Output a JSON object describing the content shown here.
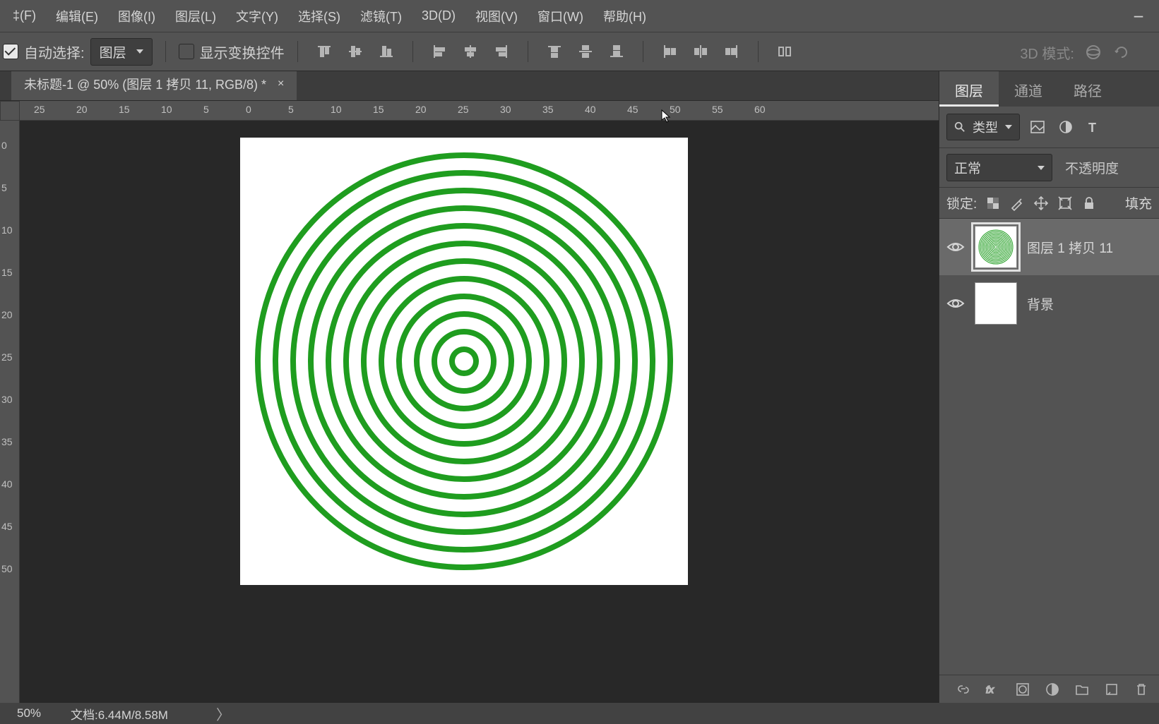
{
  "menu": {
    "file": "‡(F)",
    "edit": "编辑(E)",
    "image": "图像(I)",
    "layer": "图层(L)",
    "type": "文字(Y)",
    "select": "选择(S)",
    "filter": "滤镜(T)",
    "threeD": "3D(D)",
    "view": "视图(V)",
    "window": "窗口(W)",
    "help": "帮助(H)"
  },
  "options": {
    "auto_select": "自动选择:",
    "select_target": "图层",
    "show_transform": "显示变换控件",
    "mode3d": "3D 模式:"
  },
  "tab": {
    "title": "未标题-1 @ 50% (图层 1 拷贝 11, RGB/8) *"
  },
  "ruler_h": [
    "25",
    "20",
    "15",
    "10",
    "5",
    "0",
    "5",
    "10",
    "15",
    "20",
    "25",
    "30",
    "35",
    "40",
    "45",
    "50",
    "55",
    "60"
  ],
  "ruler_v": [
    "0",
    "5",
    "10",
    "15",
    "20",
    "25",
    "30",
    "35",
    "40",
    "45",
    "50"
  ],
  "panel": {
    "tabs": {
      "layers": "图层",
      "channels": "通道",
      "paths": "路径"
    },
    "filter_type": "类型",
    "blend_mode": "正常",
    "opacity_label": "不透明度",
    "lock_label": "锁定:",
    "fill_label": "填充",
    "layers": [
      {
        "name": "图层 1 拷贝 11"
      },
      {
        "name": "背景"
      }
    ]
  },
  "status": {
    "zoom": "50%",
    "doc": "文档:6.44M/8.58M"
  },
  "chart_data": {
    "type": "other",
    "description": "Concentric circles canvas artwork",
    "ring_count": 12,
    "stroke_color": "#1f9d1f",
    "stroke_width": 8,
    "canvas_bg": "#ffffff"
  }
}
